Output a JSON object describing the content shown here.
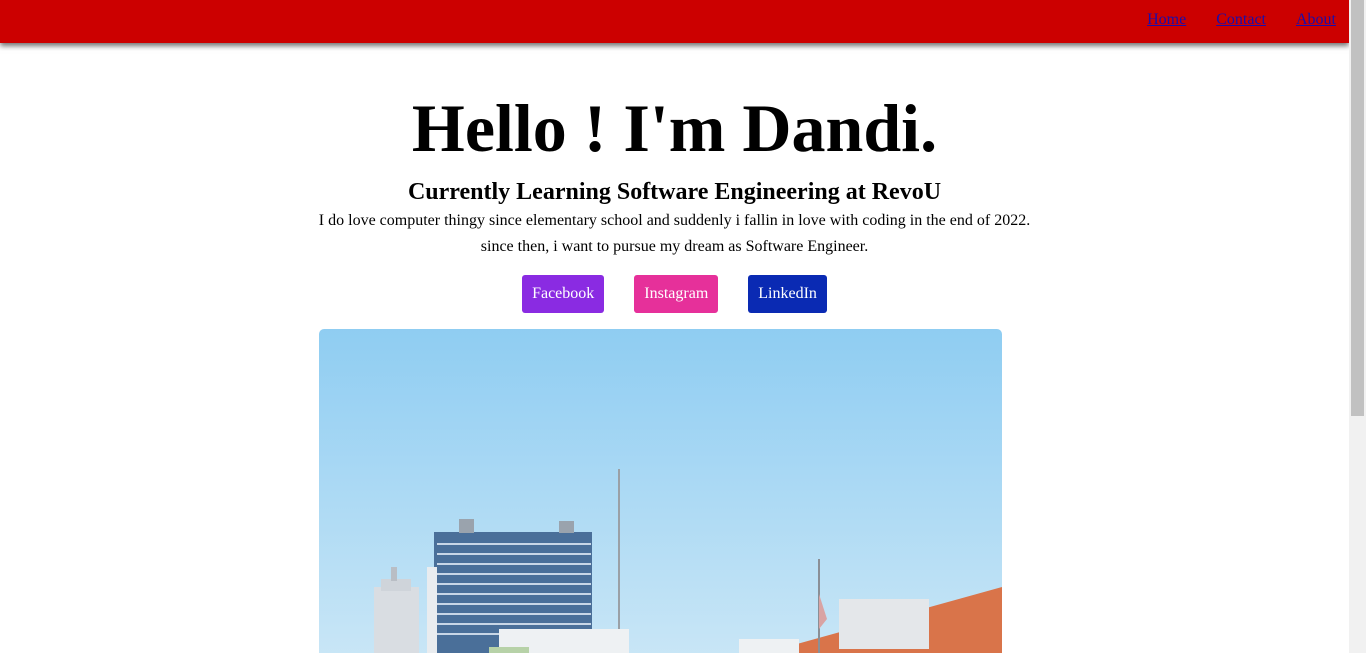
{
  "nav": {
    "links": [
      "Home",
      "Contact",
      "About"
    ]
  },
  "hero": {
    "title": "Hello ! I'm Dandi.",
    "subtitle": "Currently Learning Software Engineering at RevoU",
    "description_line1": "I do love computer thingy since elementary school and suddenly i fallin in love with coding in the end of 2022.",
    "description_line2": "since then, i want to pursue my dream as Software Engineer."
  },
  "social": {
    "buttons": [
      {
        "label": "Facebook",
        "color": "#8a2be2"
      },
      {
        "label": "Instagram",
        "color": "#e6309a"
      },
      {
        "label": "LinkedIn",
        "color": "#0a2ab3"
      }
    ]
  },
  "colors": {
    "navbar": "#cc0000",
    "link": "#1a0dab"
  }
}
